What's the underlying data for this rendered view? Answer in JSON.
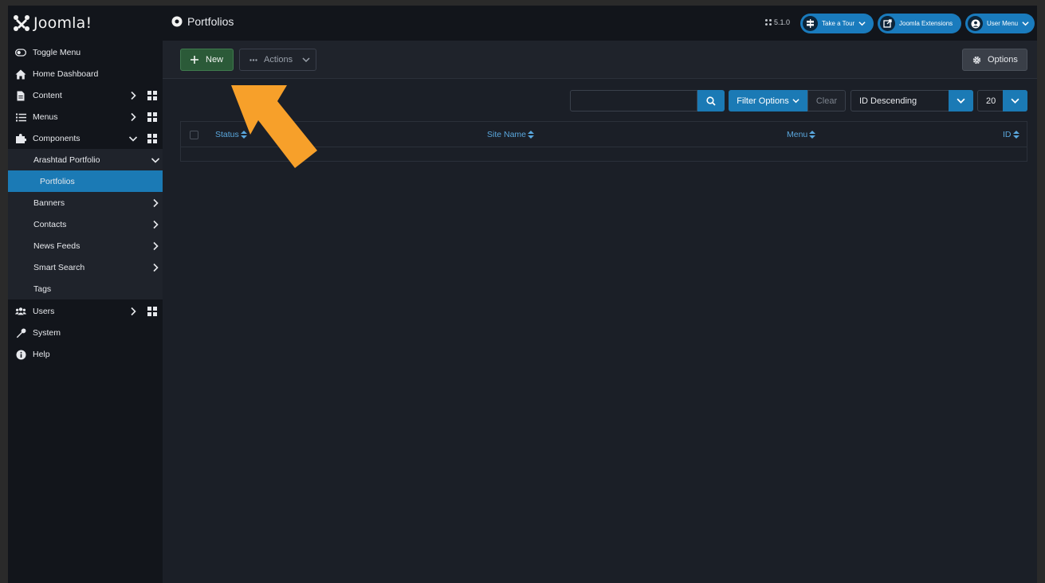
{
  "header": {
    "logo_text": "Joomla!",
    "page_title": "Portfolios",
    "version": "5.1.0",
    "buttons": [
      {
        "label": "Take a Tour",
        "icon": "signpost-icon"
      },
      {
        "label": "Joomla Extensions",
        "icon": "external-link-icon"
      },
      {
        "label": "User Menu",
        "icon": "user-icon"
      }
    ]
  },
  "sidebar": {
    "items": [
      {
        "label": "Toggle Menu",
        "icon": "toggle-icon"
      },
      {
        "label": "Home Dashboard",
        "icon": "home-icon"
      },
      {
        "label": "Content",
        "icon": "file-icon"
      },
      {
        "label": "Menus",
        "icon": "list-icon"
      },
      {
        "label": "Components",
        "icon": "puzzle-icon"
      },
      {
        "label": "Arashtad Portfolio"
      },
      {
        "label": "Portfolios"
      },
      {
        "label": "Banners"
      },
      {
        "label": "Contacts"
      },
      {
        "label": "News Feeds"
      },
      {
        "label": "Smart Search"
      },
      {
        "label": "Tags"
      },
      {
        "label": "Users",
        "icon": "users-icon"
      },
      {
        "label": "System",
        "icon": "wrench-icon"
      },
      {
        "label": "Help",
        "icon": "info-icon"
      }
    ]
  },
  "toolbar": {
    "new_label": "New",
    "actions_label": "Actions",
    "options_label": "Options"
  },
  "filters": {
    "search_value": "",
    "filter_options_label": "Filter Options",
    "clear_label": "Clear",
    "sort_value": "ID Descending",
    "limit_value": "20"
  },
  "table": {
    "columns": [
      "Status",
      "Site Name",
      "Menu",
      "ID"
    ]
  },
  "colors": {
    "accent": "#1b7ab5",
    "new_button": "#2b5a38",
    "arrow": "#f7a02a"
  }
}
